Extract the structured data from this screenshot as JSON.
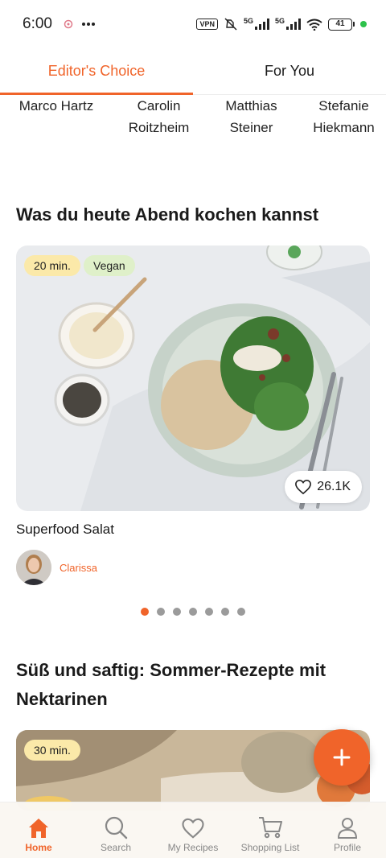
{
  "status_bar": {
    "time": "6:00",
    "vpn_label": "VPN",
    "network_1": "5G",
    "network_2": "5G",
    "battery": "41"
  },
  "tabs": [
    {
      "label": "Editor's Choice",
      "active": true
    },
    {
      "label": "For You",
      "active": false
    }
  ],
  "authors": [
    "Marco Hartz",
    "Carolin Roitzheim",
    "Matthias Steiner",
    "Stefanie Hiekmann"
  ],
  "section_1": {
    "title": "Was du heute Abend kochen kannst",
    "card": {
      "time_tag": "20 min.",
      "diet_tag": "Vegan",
      "likes": "26.1K",
      "title": "Superfood Salat",
      "author": "Clarissa"
    },
    "carousel_dots": 7,
    "active_dot": 0
  },
  "section_2": {
    "title": "Süß und saftig: Sommer-Rezepte mit Nektarinen",
    "card": {
      "time_tag": "30 min."
    }
  },
  "bottom_nav": [
    {
      "label": "Home",
      "icon": "home-icon",
      "active": true
    },
    {
      "label": "Search",
      "icon": "search-icon",
      "active": false
    },
    {
      "label": "My Recipes",
      "icon": "heart-icon",
      "active": false
    },
    {
      "label": "Shopping List",
      "icon": "cart-icon",
      "active": false
    },
    {
      "label": "Profile",
      "icon": "profile-icon",
      "active": false
    }
  ],
  "colors": {
    "accent": "#f0642a",
    "time_tag": "#fbe9a9",
    "diet_tag": "#dff0c9"
  }
}
